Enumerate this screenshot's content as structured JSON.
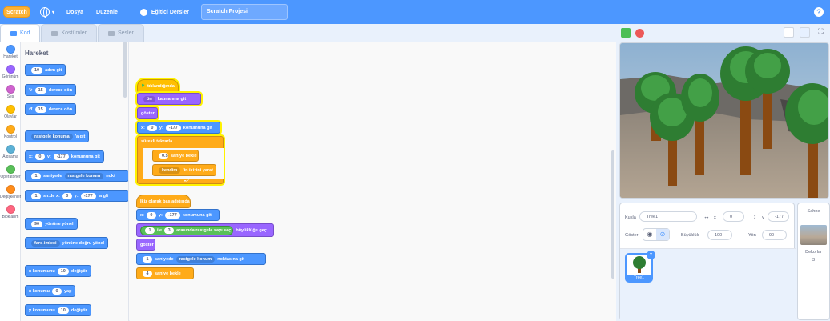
{
  "menu": {
    "logo": "Scratch",
    "file": "Dosya",
    "edit": "Düzenle",
    "tutorials": "Eğitici Dersler",
    "project_title": "Scratch Projesi",
    "help": "?"
  },
  "tabs": {
    "code": "Kod",
    "costumes": "Kostümler",
    "sounds": "Sesler"
  },
  "categories": [
    {
      "label": "Hareket",
      "color": "#4c97ff"
    },
    {
      "label": "Görünüm",
      "color": "#9966ff"
    },
    {
      "label": "Ses",
      "color": "#cf63cf"
    },
    {
      "label": "Olaylar",
      "color": "#ffbf00"
    },
    {
      "label": "Kontrol",
      "color": "#ffab19"
    },
    {
      "label": "Algılama",
      "color": "#5cb1d6"
    },
    {
      "label": "Operatörler",
      "color": "#59c059"
    },
    {
      "label": "Değişkenler",
      "color": "#ff8c1a"
    },
    {
      "label": "Bloklarım",
      "color": "#ff6680"
    }
  ],
  "palette": {
    "title": "Hareket",
    "move": {
      "v": "10",
      "t": "adım git"
    },
    "turn_right": {
      "v": "15",
      "t": "derece dön"
    },
    "turn_left": {
      "v": "15",
      "t": "derece dön"
    },
    "goto": {
      "d": "rastgele konuma",
      "t": "'a git"
    },
    "gotoxy": {
      "x": "x:",
      "xv": "0",
      "y": "y:",
      "yv": "-177",
      "t": "konumuna git"
    },
    "glide": {
      "v": "1",
      "t1": "saniyede",
      "d": "rastgele konum",
      "t2": "nokt"
    },
    "glidexy": {
      "v": "1",
      "t1": "sn.de x:",
      "xv": "0",
      "y": "y:",
      "yv": "-177",
      "t2": "'a gli"
    },
    "point": {
      "v": "90",
      "t": "yönüne yönel"
    },
    "pointto": {
      "d": "fare-imleci",
      "t": "yönüne doğru yönel"
    },
    "changex": {
      "t1": "x konumunu",
      "v": "10",
      "t2": "değiştir"
    },
    "setx": {
      "t1": "x konumu",
      "v": "0",
      "t2": "yap"
    },
    "changey": {
      "t1": "y konumunu",
      "v": "10",
      "t2": "değiştir"
    }
  },
  "script1": {
    "hat": "tıklandığında",
    "front": {
      "d": "ön",
      "t": "katmanına git"
    },
    "show": "göster",
    "goto": {
      "x": "x:",
      "xv": "0",
      "y": "y:",
      "yv": "-177",
      "t": "konumuna git"
    },
    "forever": "sürekli tekrarla",
    "wait": {
      "v": "0.5",
      "t": "saniye bekle"
    },
    "layer": {
      "d": "kendim",
      "t": "'in ikizini yarat"
    }
  },
  "script2": {
    "hat": "İkiz olarak başladığında",
    "goto": {
      "x": "x:",
      "xv": "0",
      "y": "y:",
      "yv": "-177",
      "t": "konumuna git"
    },
    "size": {
      "v1": "1",
      "t1": "ile",
      "v2": "3",
      "t2": "arasında rastgele sayı seç",
      "t3": "büyüklüğe geç"
    },
    "show": "göster",
    "glide": {
      "v": "1",
      "t1": "saniyede",
      "d": "rastgele konum",
      "t2": "noktasına git"
    },
    "wait": {
      "v": "4",
      "t": "saniye bekle"
    }
  },
  "sprite": {
    "label": "Kukla",
    "name": "Tree1",
    "x_label": "x",
    "x": "0",
    "y_label": "y",
    "y": "-177",
    "show_label": "Göster",
    "size_label": "Büyüklük",
    "size": "100",
    "dir_label": "Yön",
    "dir": "90",
    "thumb_name": "Tree1"
  },
  "stage": {
    "title": "Sahne",
    "backdrops_label": "Dekorlar",
    "backdrops": "3"
  }
}
